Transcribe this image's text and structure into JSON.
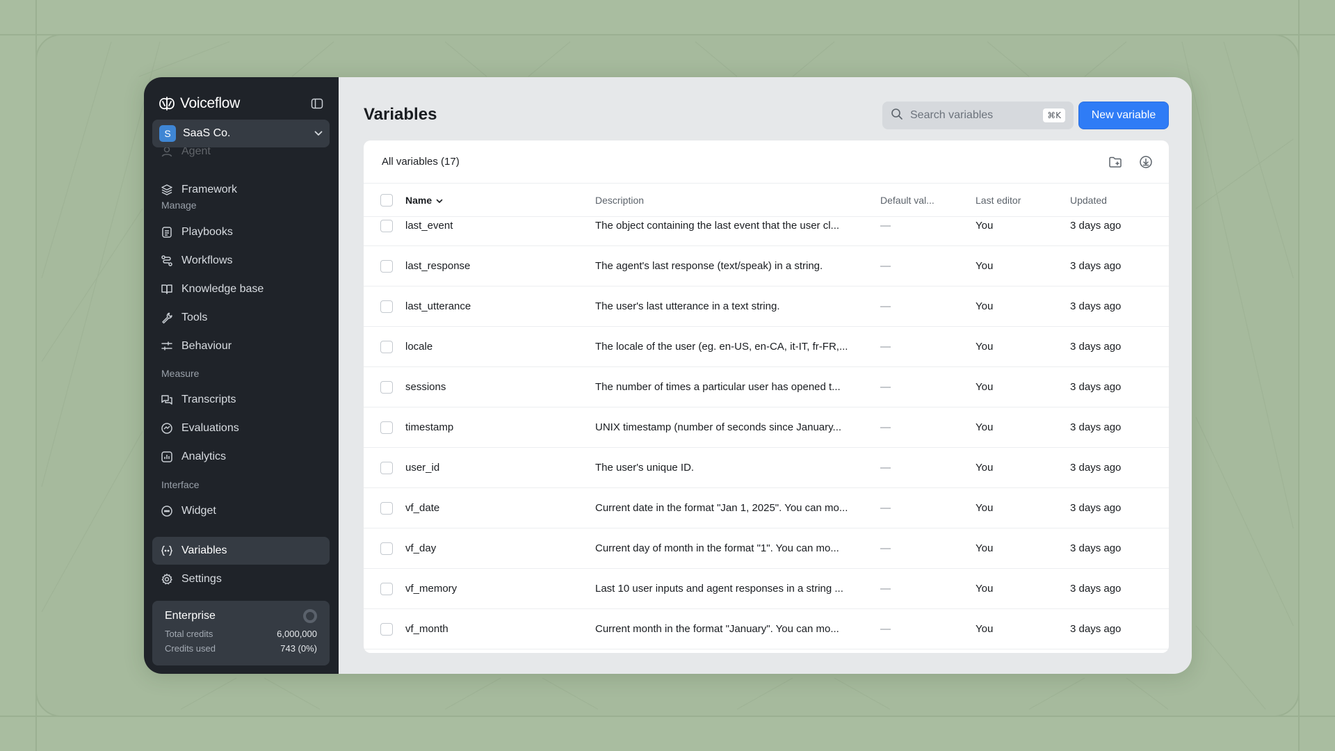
{
  "brand": {
    "name": "Voiceflow"
  },
  "workspace": {
    "badge": "S",
    "name": "SaaS Co."
  },
  "sidebar": {
    "partial_item": "Agent",
    "items_top": [
      {
        "label": "Framework",
        "icon": "layers-icon"
      }
    ],
    "sections": [
      {
        "title": "Manage",
        "items": [
          {
            "label": "Playbooks",
            "icon": "document-icon"
          },
          {
            "label": "Workflows",
            "icon": "workflow-icon"
          },
          {
            "label": "Knowledge base",
            "icon": "book-icon"
          },
          {
            "label": "Tools",
            "icon": "wrench-icon"
          },
          {
            "label": "Behaviour",
            "icon": "sliders-icon"
          }
        ]
      },
      {
        "title": "Measure",
        "items": [
          {
            "label": "Transcripts",
            "icon": "chat-icon"
          },
          {
            "label": "Evaluations",
            "icon": "gauge-icon"
          },
          {
            "label": "Analytics",
            "icon": "chart-icon"
          }
        ]
      },
      {
        "title": "Interface",
        "items": [
          {
            "label": "Widget",
            "icon": "widget-icon"
          }
        ]
      }
    ],
    "bottom_items": [
      {
        "label": "Variables",
        "icon": "variable-icon",
        "active": true
      },
      {
        "label": "Settings",
        "icon": "gear-icon"
      }
    ]
  },
  "credits": {
    "plan": "Enterprise",
    "total_label": "Total credits",
    "total_value": "6,000,000",
    "used_label": "Credits used",
    "used_value": "743 (0%)"
  },
  "page": {
    "title": "Variables"
  },
  "search": {
    "placeholder": "Search variables",
    "shortcut": "⌘K"
  },
  "new_button": {
    "label": "New variable"
  },
  "card": {
    "title": "All variables (17)"
  },
  "table": {
    "columns": {
      "name": "Name",
      "description": "Description",
      "default": "Default val...",
      "editor": "Last editor",
      "updated": "Updated"
    },
    "rows": [
      {
        "name": "last_event",
        "description": "The object containing the last event that the user cl...",
        "default": "—",
        "editor": "You",
        "updated": "3 days ago"
      },
      {
        "name": "last_response",
        "description": "The agent's last response (text/speak) in a string.",
        "default": "—",
        "editor": "You",
        "updated": "3 days ago"
      },
      {
        "name": "last_utterance",
        "description": "The user's last utterance in a text string.",
        "default": "—",
        "editor": "You",
        "updated": "3 days ago"
      },
      {
        "name": "locale",
        "description": "The locale of the user (eg. en-US, en-CA, it-IT, fr-FR,...",
        "default": "—",
        "editor": "You",
        "updated": "3 days ago"
      },
      {
        "name": "sessions",
        "description": "The number of times a particular user has opened t...",
        "default": "—",
        "editor": "You",
        "updated": "3 days ago"
      },
      {
        "name": "timestamp",
        "description": "UNIX timestamp (number of seconds since January...",
        "default": "—",
        "editor": "You",
        "updated": "3 days ago"
      },
      {
        "name": "user_id",
        "description": "The user's unique ID.",
        "default": "—",
        "editor": "You",
        "updated": "3 days ago"
      },
      {
        "name": "vf_date",
        "description": "Current date in the format \"Jan 1, 2025\". You can mo...",
        "default": "—",
        "editor": "You",
        "updated": "3 days ago"
      },
      {
        "name": "vf_day",
        "description": "Current day of month in the format \"1\". You can mo...",
        "default": "—",
        "editor": "You",
        "updated": "3 days ago"
      },
      {
        "name": "vf_memory",
        "description": "Last 10 user inputs and agent responses in a string ...",
        "default": "—",
        "editor": "You",
        "updated": "3 days ago"
      },
      {
        "name": "vf_month",
        "description": "Current month in the format \"January\". You can mo...",
        "default": "—",
        "editor": "You",
        "updated": "3 days ago"
      }
    ]
  },
  "colors": {
    "accent": "#2f7cf6",
    "sidebar_bg": "#1f2329",
    "page_bg": "#a9bda0",
    "workspace_badge": "#3f86d4"
  }
}
